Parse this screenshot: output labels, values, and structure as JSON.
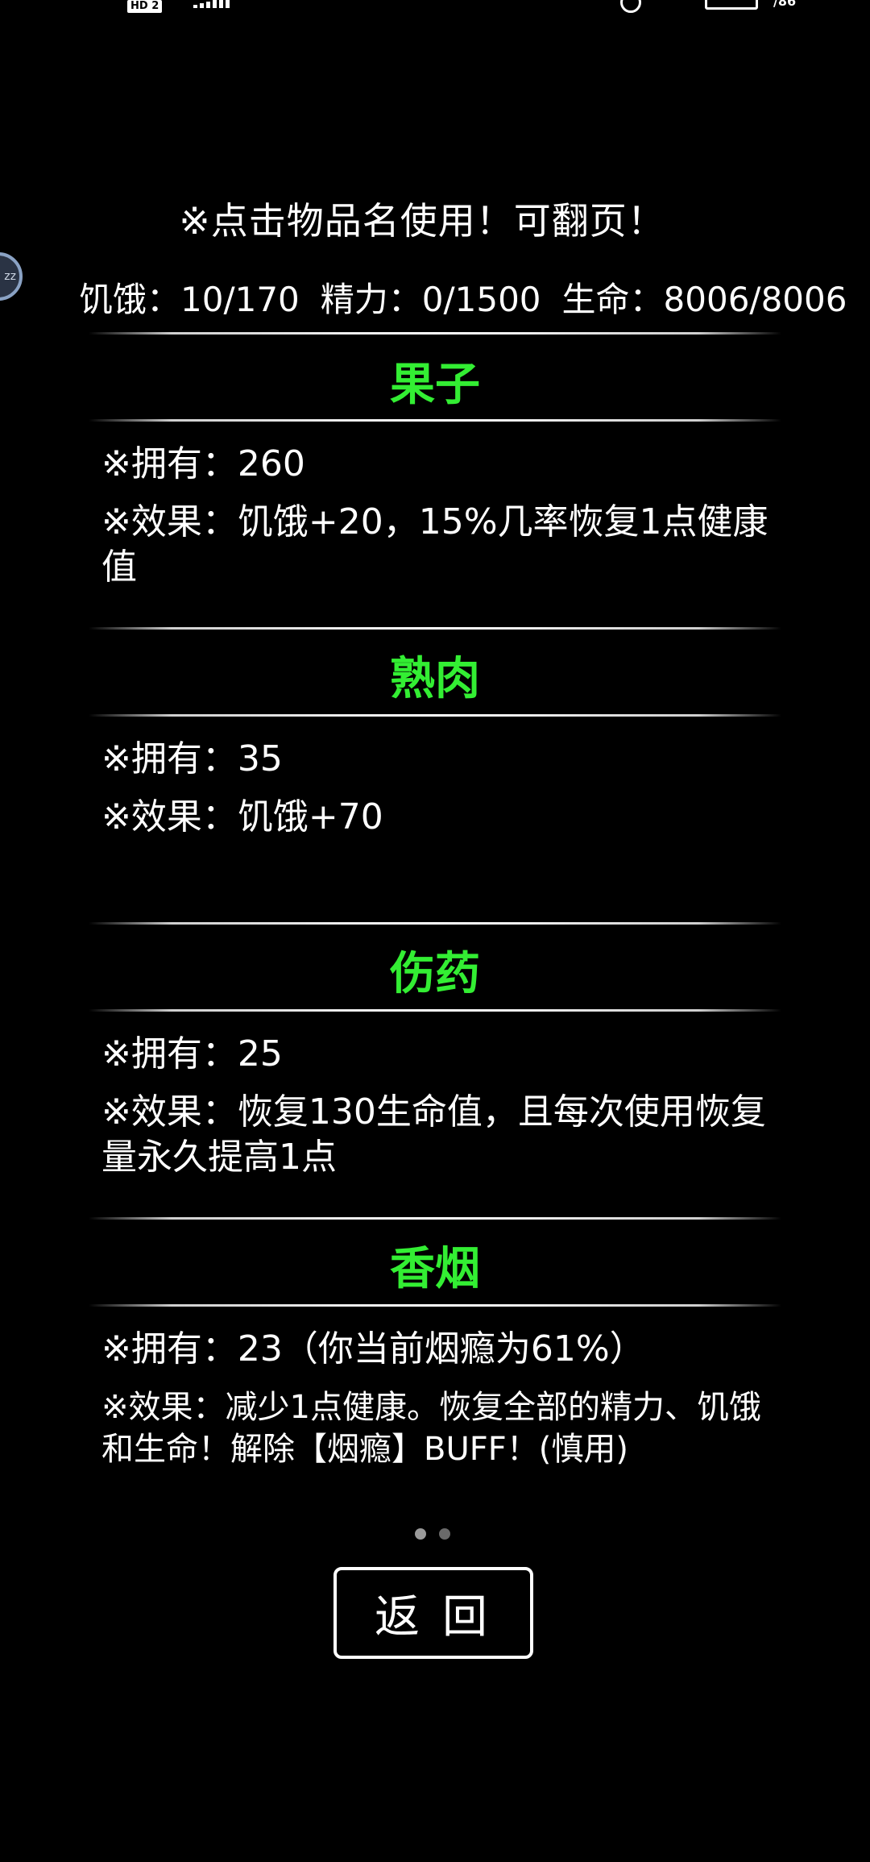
{
  "status_bar": {
    "hd_badge": "HD 2",
    "time_fragment": "/86"
  },
  "hint": "※点击物品名使用！可翻页！",
  "stats": {
    "hunger": "饥饿：10/170",
    "energy": "精力：0/1500",
    "life": "生命：8006/8006"
  },
  "items": [
    {
      "name": "果子",
      "owned": "※拥有：260",
      "effect": "※效果：饥饿+20，15%几率恢复1点健康值"
    },
    {
      "name": "熟肉",
      "owned": "※拥有：35",
      "effect": "※效果：饥饿+70"
    },
    {
      "name": "伤药",
      "owned": "※拥有：25",
      "effect": "※效果：恢复130生命值，且每次使用恢复量永久提高1点"
    },
    {
      "name": "香烟",
      "owned": "※拥有：23（你当前烟瘾为61%）",
      "effect": "※效果：减少1点健康。恢复全部的精力、饥饿和生命！解除【烟瘾】BUFF！(慎用)"
    }
  ],
  "pager": {
    "current": 1,
    "total": 2
  },
  "back_button": "返回",
  "colors": {
    "background": "#000000",
    "item_title": "#33ee33",
    "text": "#ffffff"
  }
}
